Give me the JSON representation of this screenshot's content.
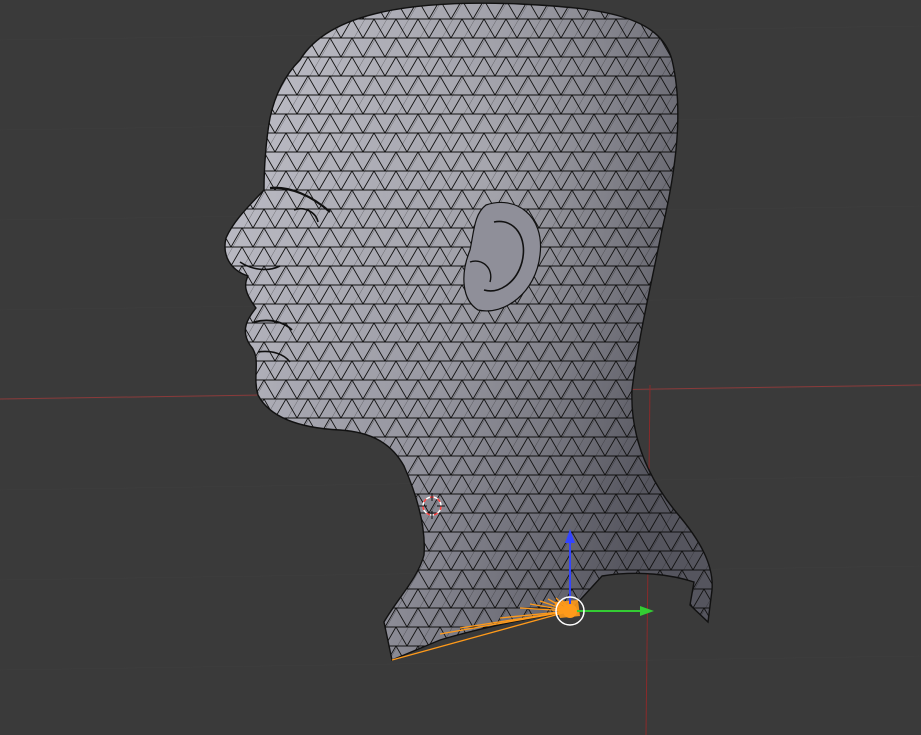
{
  "viewport": {
    "background": "#3a3a3a",
    "grid_color": "#494949",
    "axis_x_color": "#8a3a3a",
    "axis_z_color": "#8a2a2a"
  },
  "mesh": {
    "shape": "human-head-profile",
    "shading": "solid-with-wireframe",
    "surface_light": "#c3c3cc",
    "surface_mid": "#8f8f99",
    "surface_dark": "#55555e",
    "wire_color": "#111111"
  },
  "selection": {
    "color": "#ff9a1a",
    "state": "edges-selected"
  },
  "cursor_3d": {
    "icon": "crosshair-circle-icon",
    "color_a": "#ff4040",
    "color_b": "#ffffff"
  },
  "manipulator": {
    "icon": "translate-gizmo-icon",
    "y_color": "#33cc33",
    "z_color": "#3344ff",
    "center_color": "#ffffff"
  }
}
